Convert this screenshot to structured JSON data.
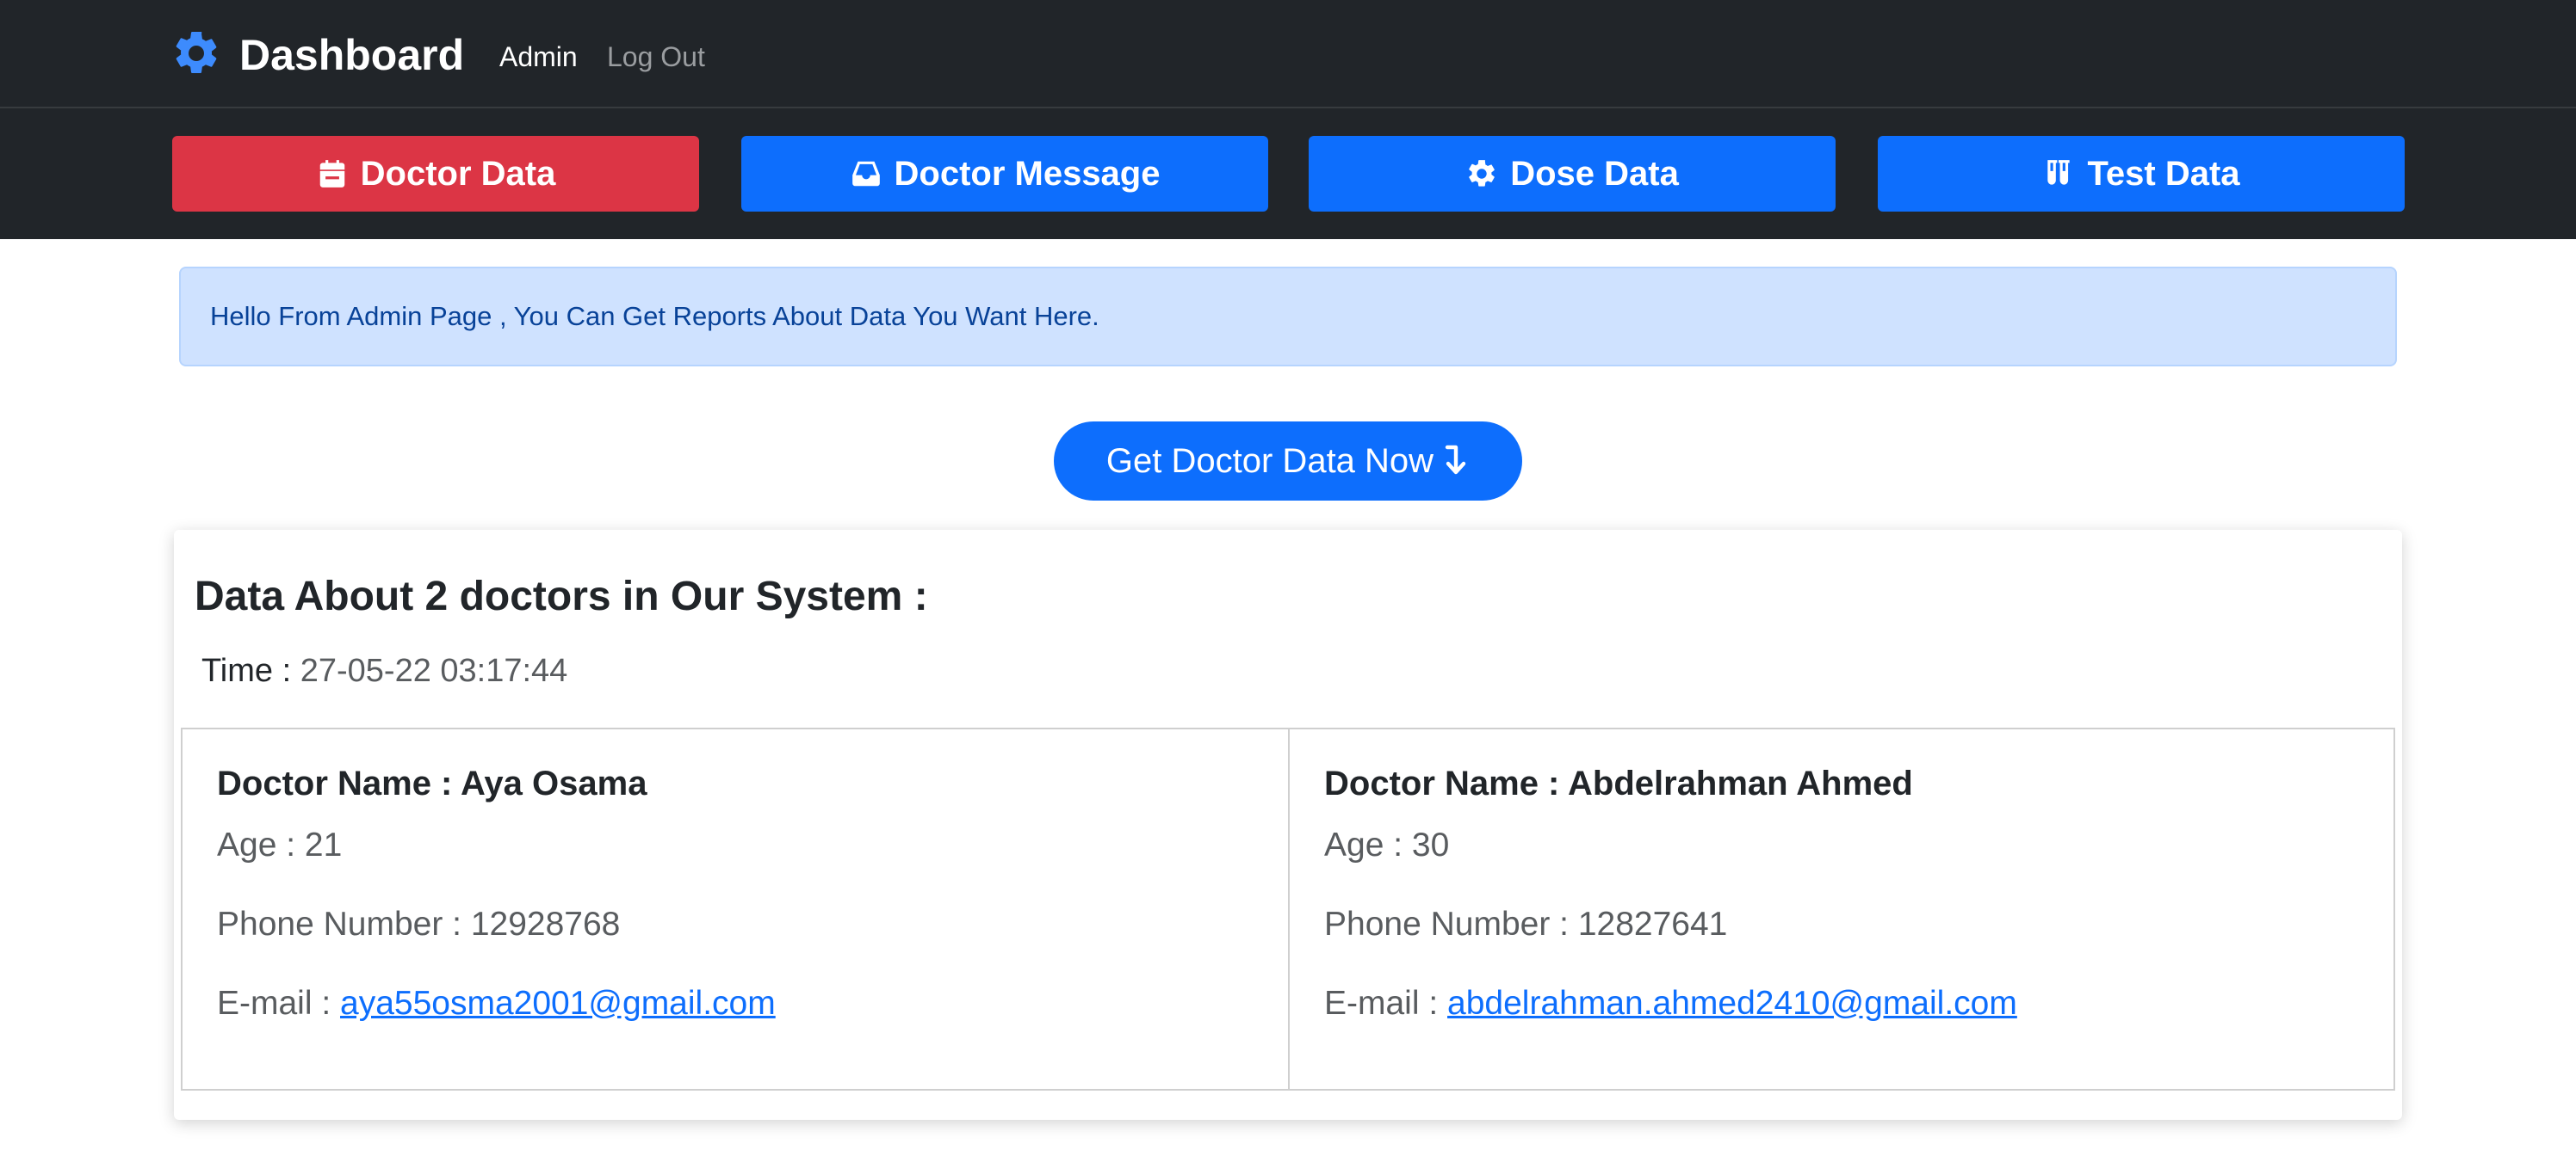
{
  "nav": {
    "brand": "Dashboard",
    "links": [
      "Admin",
      "Log Out"
    ]
  },
  "actions": {
    "doctor_data": "Doctor Data",
    "doctor_message": "Doctor Message",
    "dose_data": "Dose Data",
    "test_data": "Test Data"
  },
  "alert": "Hello From Admin Page , You Can Get Reports About Data You Want Here.",
  "get_button": "Get Doctor Data Now",
  "card": {
    "title": "Data About 2 doctors in Our System :",
    "time_label": "Time :",
    "time_value": "27-05-22 03:17:44"
  },
  "doctors": [
    {
      "name": "Doctor Name : Aya Osama",
      "age": "Age : 21",
      "phone": "Phone Number : 12928768",
      "email_label": "E-mail :",
      "email": "aya55osma2001@gmail.com"
    },
    {
      "name": "Doctor Name : Abdelrahman Ahmed",
      "age": "Age : 30",
      "phone": "Phone Number : 12827641",
      "email_label": "E-mail :",
      "email": "abdelrahman.ahmed2410@gmail.com"
    }
  ],
  "colors": {
    "navbar": "#212529",
    "primary": "#0d6efd",
    "danger": "#dc3545",
    "alert_bg": "#cfe2ff",
    "alert_text": "#084298"
  },
  "icons": {
    "brand": "gear-icon",
    "doctor_data": "calendar-icon",
    "doctor_message": "inbox-icon",
    "dose_data": "gear-icon",
    "test_data": "test-tubes-icon",
    "get_button": "arrow-down-icon"
  }
}
